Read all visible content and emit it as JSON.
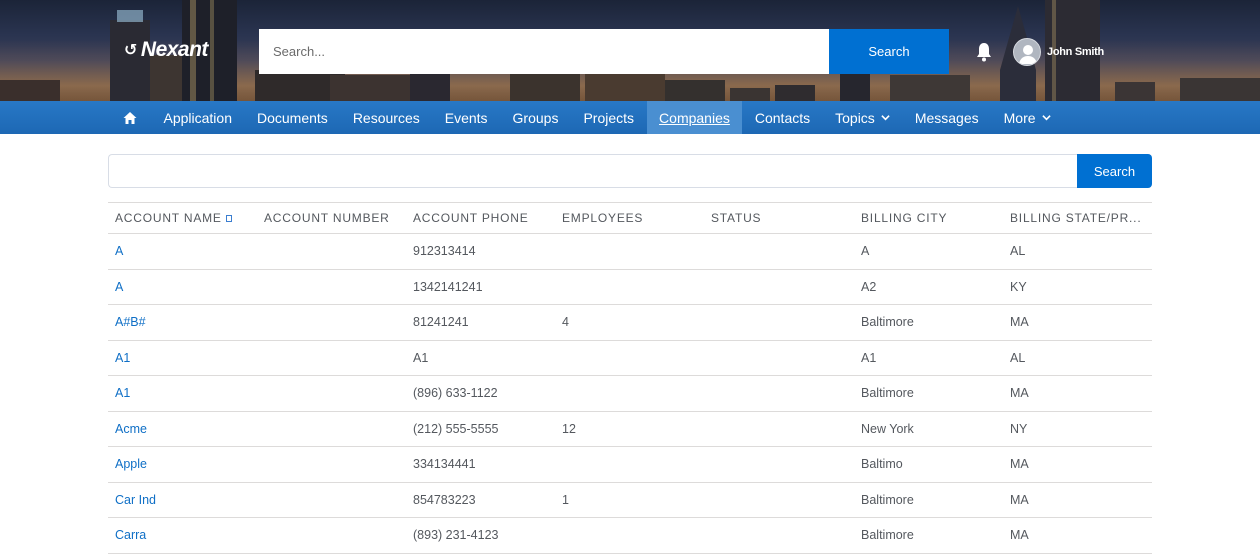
{
  "header": {
    "logo_text": "Nexant",
    "search_placeholder": "Search...",
    "search_button": "Search",
    "user_name": "John Smith"
  },
  "nav": {
    "items": [
      {
        "label": "Application"
      },
      {
        "label": "Documents"
      },
      {
        "label": "Resources"
      },
      {
        "label": "Events"
      },
      {
        "label": "Groups"
      },
      {
        "label": "Projects"
      },
      {
        "label": "Companies",
        "active": true
      },
      {
        "label": "Contacts"
      },
      {
        "label": "Topics",
        "dropdown": true
      },
      {
        "label": "Messages"
      },
      {
        "label": "More",
        "dropdown": true
      }
    ]
  },
  "list_search": {
    "value": "",
    "button": "Search"
  },
  "table": {
    "columns": [
      "ACCOUNT NAME",
      "ACCOUNT NUMBER",
      "ACCOUNT PHONE",
      "EMPLOYEES",
      "STATUS",
      "BILLING CITY",
      "BILLING STATE/PR..."
    ],
    "rows": [
      [
        "A",
        "",
        "912313414",
        "",
        "",
        "A",
        "AL"
      ],
      [
        "A",
        "",
        "1342141241",
        "",
        "",
        "A2",
        "KY"
      ],
      [
        "A#B#",
        "",
        "81241241",
        "4",
        "",
        "Baltimore",
        "MA"
      ],
      [
        "A1",
        "",
        "A1",
        "",
        "",
        "A1",
        "AL"
      ],
      [
        "A1",
        "",
        "(896) 633-1122",
        "",
        "",
        "Baltimore",
        "MA"
      ],
      [
        "Acme",
        "",
        "(212) 555-5555",
        "12",
        "",
        "New York",
        "NY"
      ],
      [
        "Apple",
        "",
        "334134441",
        "",
        "",
        "Baltimo",
        "MA"
      ],
      [
        "Car Ind",
        "",
        "854783223",
        "1",
        "",
        "Baltimore",
        "MA"
      ],
      [
        "Carra",
        "",
        "(893) 231-4123",
        "",
        "",
        "Baltimore",
        "MA"
      ]
    ]
  },
  "colors": {
    "brand_blue": "#0070d2",
    "nav_blue": "#1f6fbe",
    "link_blue": "#0f6fc6"
  }
}
